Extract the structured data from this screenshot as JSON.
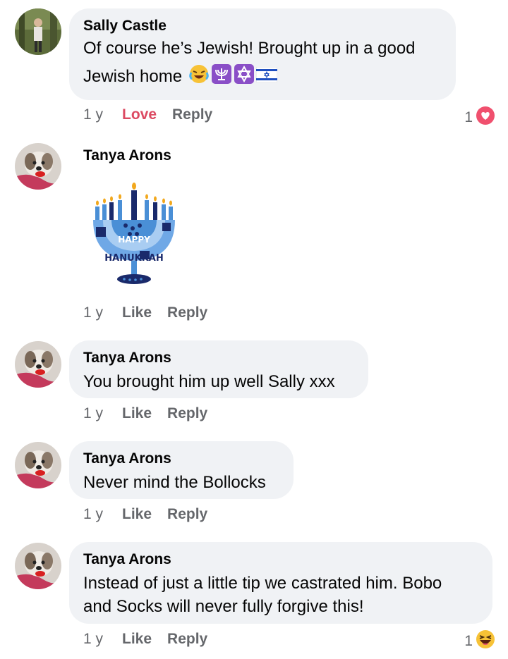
{
  "comments": [
    {
      "author": "Sally Castle",
      "text": "Of course he’s Jewish! Brought up in a good",
      "text_line2": "Jewish home",
      "emojis": [
        "laughing-crying-emoji",
        "menorah-emoji",
        "star-of-david-emoji",
        "israel-flag-emoji"
      ],
      "time": "1 y",
      "reaction_action": "Love",
      "reply": "Reply",
      "reaction_count": "1",
      "reaction_icon": "heart-icon"
    },
    {
      "author": "Tanya Arons",
      "sticker_text_top": "HAPPY",
      "sticker_text_bottom": "HANUKKAH",
      "time": "1 y",
      "like": "Like",
      "reply": "Reply"
    },
    {
      "author": "Tanya Arons",
      "text": "You brought him up well Sally xxx",
      "time": "1 y",
      "like": "Like",
      "reply": "Reply"
    },
    {
      "author": "Tanya Arons",
      "text": "Never mind the Bollocks",
      "time": "1 y",
      "like": "Like",
      "reply": "Reply"
    },
    {
      "author": "Tanya Arons",
      "text": "Instead of just a little tip we castrated him.  Bobo",
      "text_line2": "and Socks will never fully forgive this!",
      "time": "1 y",
      "like": "Like",
      "reply": "Reply",
      "reaction_count": "1",
      "reaction_icon": "haha-laugh-icon"
    }
  ],
  "colors": {
    "bubble": "#f0f2f5",
    "muted": "#65676b",
    "love": "#dc4a62",
    "sticker_blue": "#4a8fd6",
    "sticker_dark": "#1a2a6b"
  }
}
